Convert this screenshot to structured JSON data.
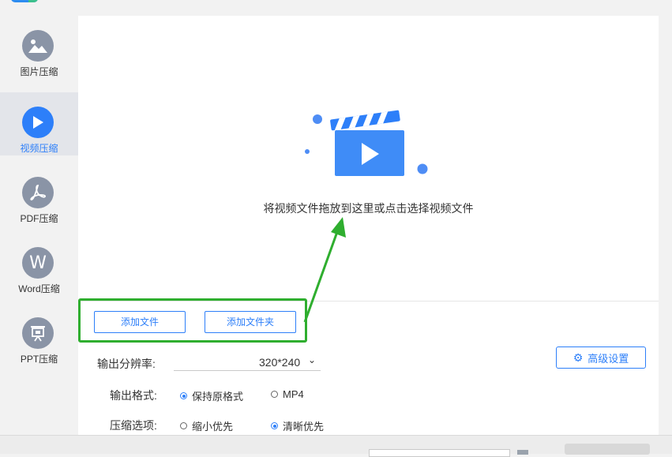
{
  "sidebar": {
    "items": [
      {
        "label": "图片压缩",
        "icon": "image-icon",
        "active": false
      },
      {
        "label": "视频压缩",
        "icon": "play-icon",
        "active": true
      },
      {
        "label": "PDF压缩",
        "icon": "pdf-icon",
        "active": false
      },
      {
        "label": "Word压缩",
        "icon": "word-icon",
        "active": false
      },
      {
        "label": "PPT压缩",
        "icon": "ppt-icon",
        "active": false
      }
    ],
    "word_icon_letter": "W"
  },
  "drop_zone": {
    "hint": "将视频文件拖放到这里或点击选择视频文件",
    "icon": "clapperboard-icon"
  },
  "actions": {
    "add_file": "添加文件",
    "add_folder": "添加文件夹"
  },
  "settings": {
    "resolution_label": "输出分辨率:",
    "resolution_value": "320*240",
    "format_label": "输出格式:",
    "format_options": [
      {
        "label": "保持原格式",
        "selected": true
      },
      {
        "label": "MP4",
        "selected": false
      }
    ],
    "compress_label": "压缩选项:",
    "compress_options": [
      {
        "label": "缩小优先",
        "selected": false
      },
      {
        "label": "清晰优先",
        "selected": true
      }
    ],
    "advanced_label": "高级设置"
  },
  "colors": {
    "accent": "#2d7ff9",
    "annotation": "#2fae2f",
    "sidebar_bg": "#f2f2f2"
  }
}
